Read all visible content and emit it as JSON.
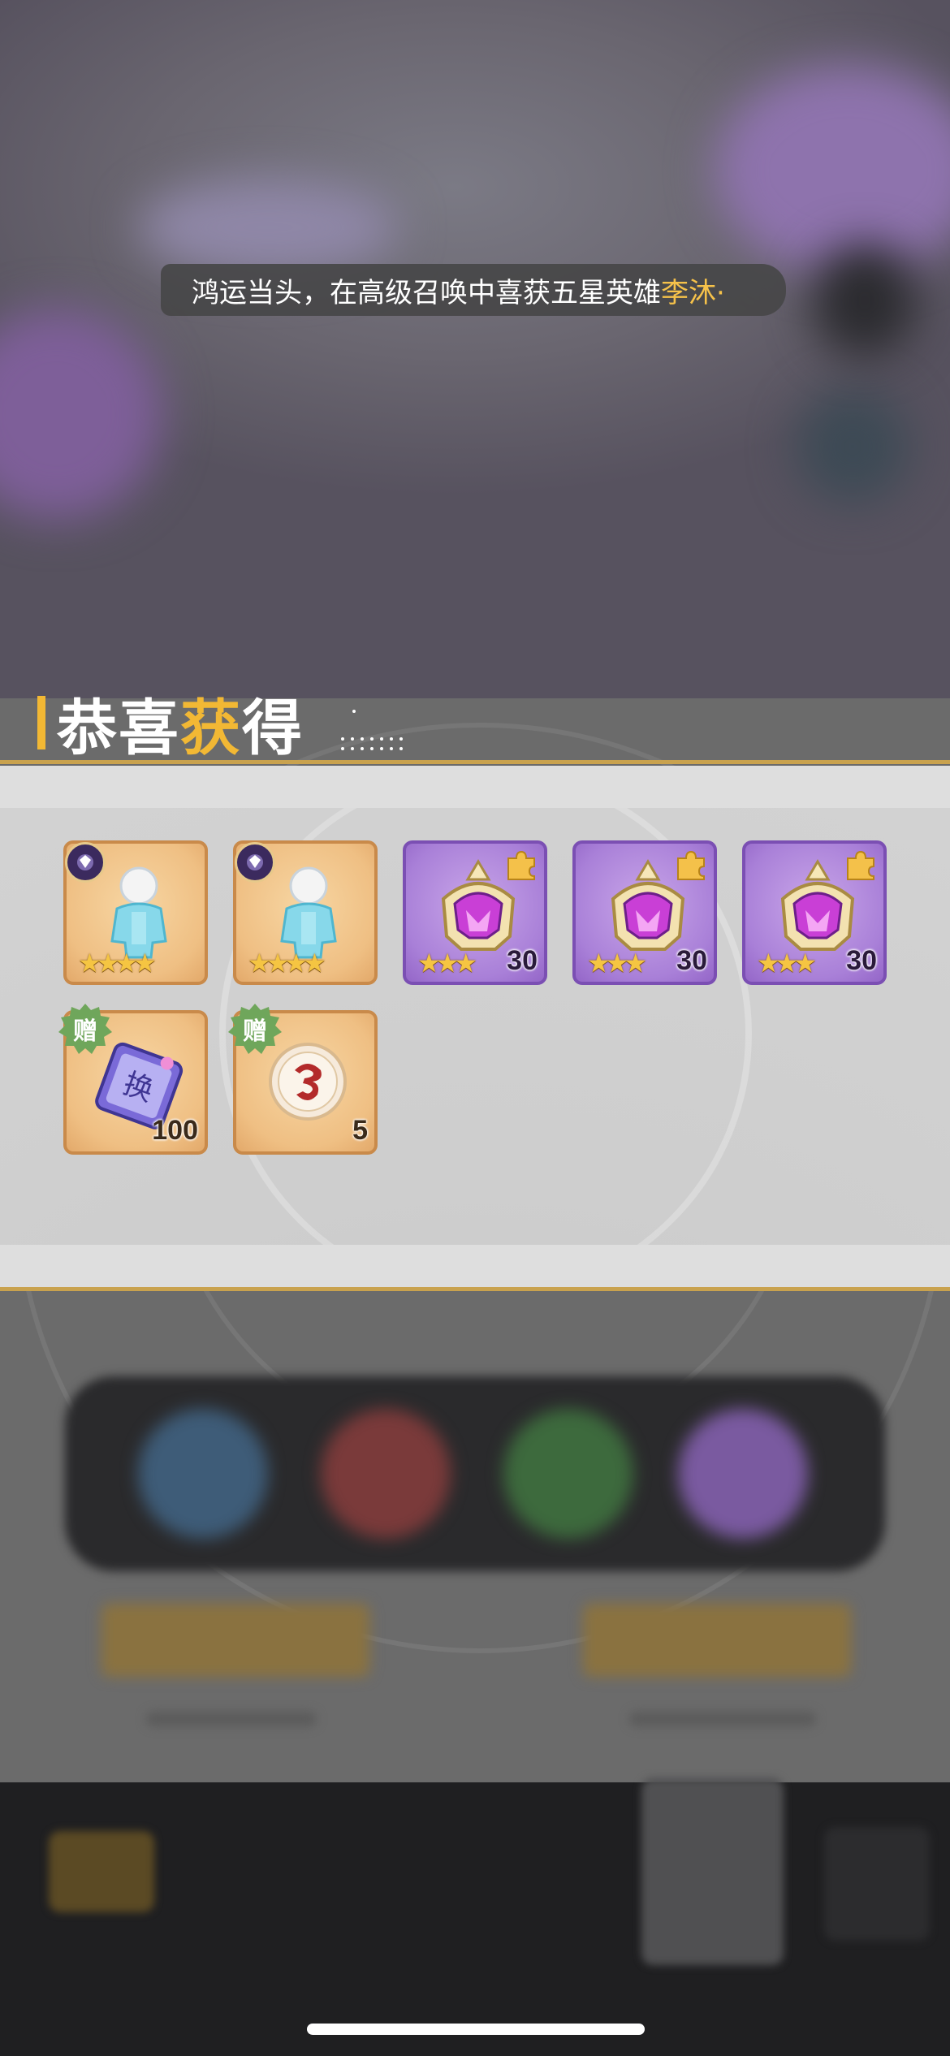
{
  "toast": {
    "message": "鸿运当头，在高级召唤中喜获五星英雄",
    "highlight": "李沐·"
  },
  "reward_panel": {
    "title_part1": "恭喜",
    "title_part2": "获",
    "title_part3": "得",
    "items": [
      {
        "name": "hero-shard",
        "stars": "★★★★",
        "quantity": ""
      },
      {
        "name": "hero-shard",
        "stars": "★★★★",
        "quantity": ""
      },
      {
        "name": "purple-helmet",
        "stars": "★★★",
        "quantity": "30"
      },
      {
        "name": "purple-helmet",
        "stars": "★★★",
        "quantity": "30"
      },
      {
        "name": "purple-helmet",
        "stars": "★★★",
        "quantity": "30"
      },
      {
        "name": "exchange-ticket",
        "badge": "赠",
        "ticket_char": "换",
        "quantity": "100"
      },
      {
        "name": "dragon-token",
        "badge": "赠",
        "quantity": "5"
      }
    ]
  },
  "colors": {
    "accent_gold": "#f2b834",
    "toast_highlight": "#f6c24a",
    "gift_badge": "#6fa65b"
  }
}
